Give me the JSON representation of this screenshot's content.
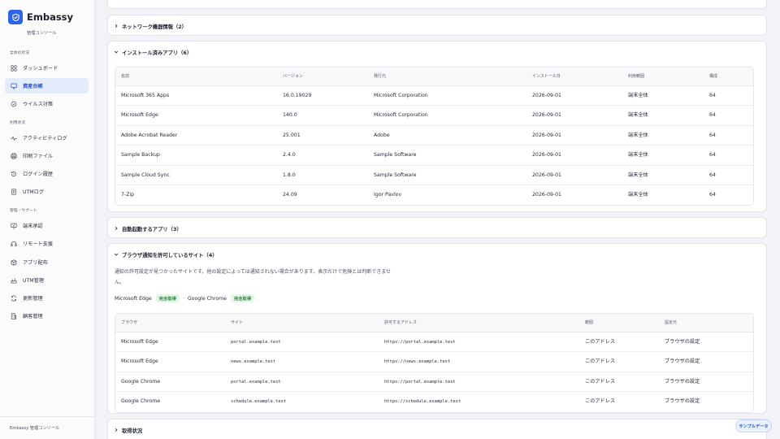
{
  "brand": {
    "name": "Embassy",
    "subtitle": "管理コンソール"
  },
  "sidebar": {
    "sections": [
      {
        "label": "全体の状況"
      },
      {
        "label": "利用状況"
      },
      {
        "label": "管理・サポート"
      }
    ],
    "items": [
      {
        "label": "ダッシュボード",
        "icon": "grid-icon"
      },
      {
        "label": "資産台帳",
        "icon": "monitor-icon",
        "active": true
      },
      {
        "label": "ウイルス対策",
        "icon": "shield-check-icon"
      },
      {
        "label": "アクティビティログ",
        "icon": "activity-icon"
      },
      {
        "label": "印刷ファイル",
        "icon": "printer-icon"
      },
      {
        "label": "ログイン履歴",
        "icon": "history-icon"
      },
      {
        "label": "UTMログ",
        "icon": "document-icon"
      },
      {
        "label": "端末承認",
        "icon": "approve-icon"
      },
      {
        "label": "リモート支援",
        "icon": "headset-icon"
      },
      {
        "label": "アプリ配布",
        "icon": "package-icon"
      },
      {
        "label": "UTM管理",
        "icon": "router-icon"
      },
      {
        "label": "更新管理",
        "icon": "refresh-icon"
      },
      {
        "label": "顧客管理",
        "icon": "building-icon"
      }
    ],
    "footer": "Embassy 管理コンソール"
  },
  "panels": {
    "network": {
      "title": "ネットワーク機器情報（2）"
    },
    "installed": {
      "title": "インストール済みアプリ（6）",
      "columns": [
        "名前",
        "バージョン",
        "発行元",
        "インストール日",
        "利用範囲",
        "構成"
      ],
      "rows": [
        [
          "Microsoft 365 Apps",
          "16.0.19029",
          "Microsoft Corporation",
          "2026-09-01",
          "端末全体",
          "64"
        ],
        [
          "Microsoft Edge",
          "140.0",
          "Microsoft Corporation",
          "2026-09-01",
          "端末全体",
          "64"
        ],
        [
          "Adobe Acrobat Reader",
          "25.001",
          "Adobe",
          "2026-09-01",
          "端末全体",
          "64"
        ],
        [
          "Sample Backup",
          "2.4.0",
          "Sample Software",
          "2026-09-01",
          "端末全体",
          "64"
        ],
        [
          "Sample Cloud Sync",
          "1.8.0",
          "Sample Software",
          "2026-09-01",
          "端末全体",
          "64"
        ],
        [
          "7-Zip",
          "24.09",
          "Igor Pavlov",
          "2026-09-01",
          "端末全体",
          "64"
        ]
      ]
    },
    "startup": {
      "title": "自動起動するアプリ（3）"
    },
    "notify": {
      "title": "ブラウザ通知を許可しているサイト（4）",
      "description": "通知の許可設定が見つかったサイトです。他の設定によっては通知されない場合があります。表示だけで危険とは判断できません。",
      "browsers": [
        {
          "name": "Microsoft Edge",
          "status": "完全取得"
        },
        {
          "name": "Google Chrome",
          "status": "完全取得"
        }
      ],
      "separator": "·",
      "columns": [
        "ブラウザ",
        "サイト",
        "許可するアドレス",
        "範囲",
        "設定元"
      ],
      "rows": [
        [
          "Microsoft Edge",
          "portal.example.test",
          "https://portal.example.test",
          "このアドレス",
          "ブラウザの設定"
        ],
        [
          "Microsoft Edge",
          "news.example.test",
          "https://news.example.test",
          "このアドレス",
          "ブラウザの設定"
        ],
        [
          "Google Chrome",
          "portal.example.test",
          "https://portal.example.test",
          "このアドレス",
          "ブラウザの設定"
        ],
        [
          "Google Chrome",
          "schedule.example.test",
          "https://schedule.example.test",
          "このアドレス",
          "ブラウザの設定"
        ]
      ]
    },
    "acquisition": {
      "title": "取得状況"
    }
  },
  "sample_button": "サンプルデータ",
  "colors": {
    "accent": "#2f64e8",
    "active_bg": "#e4ebfb",
    "badge_bg": "#e5f5e8",
    "badge_text": "#2a8a3e"
  }
}
